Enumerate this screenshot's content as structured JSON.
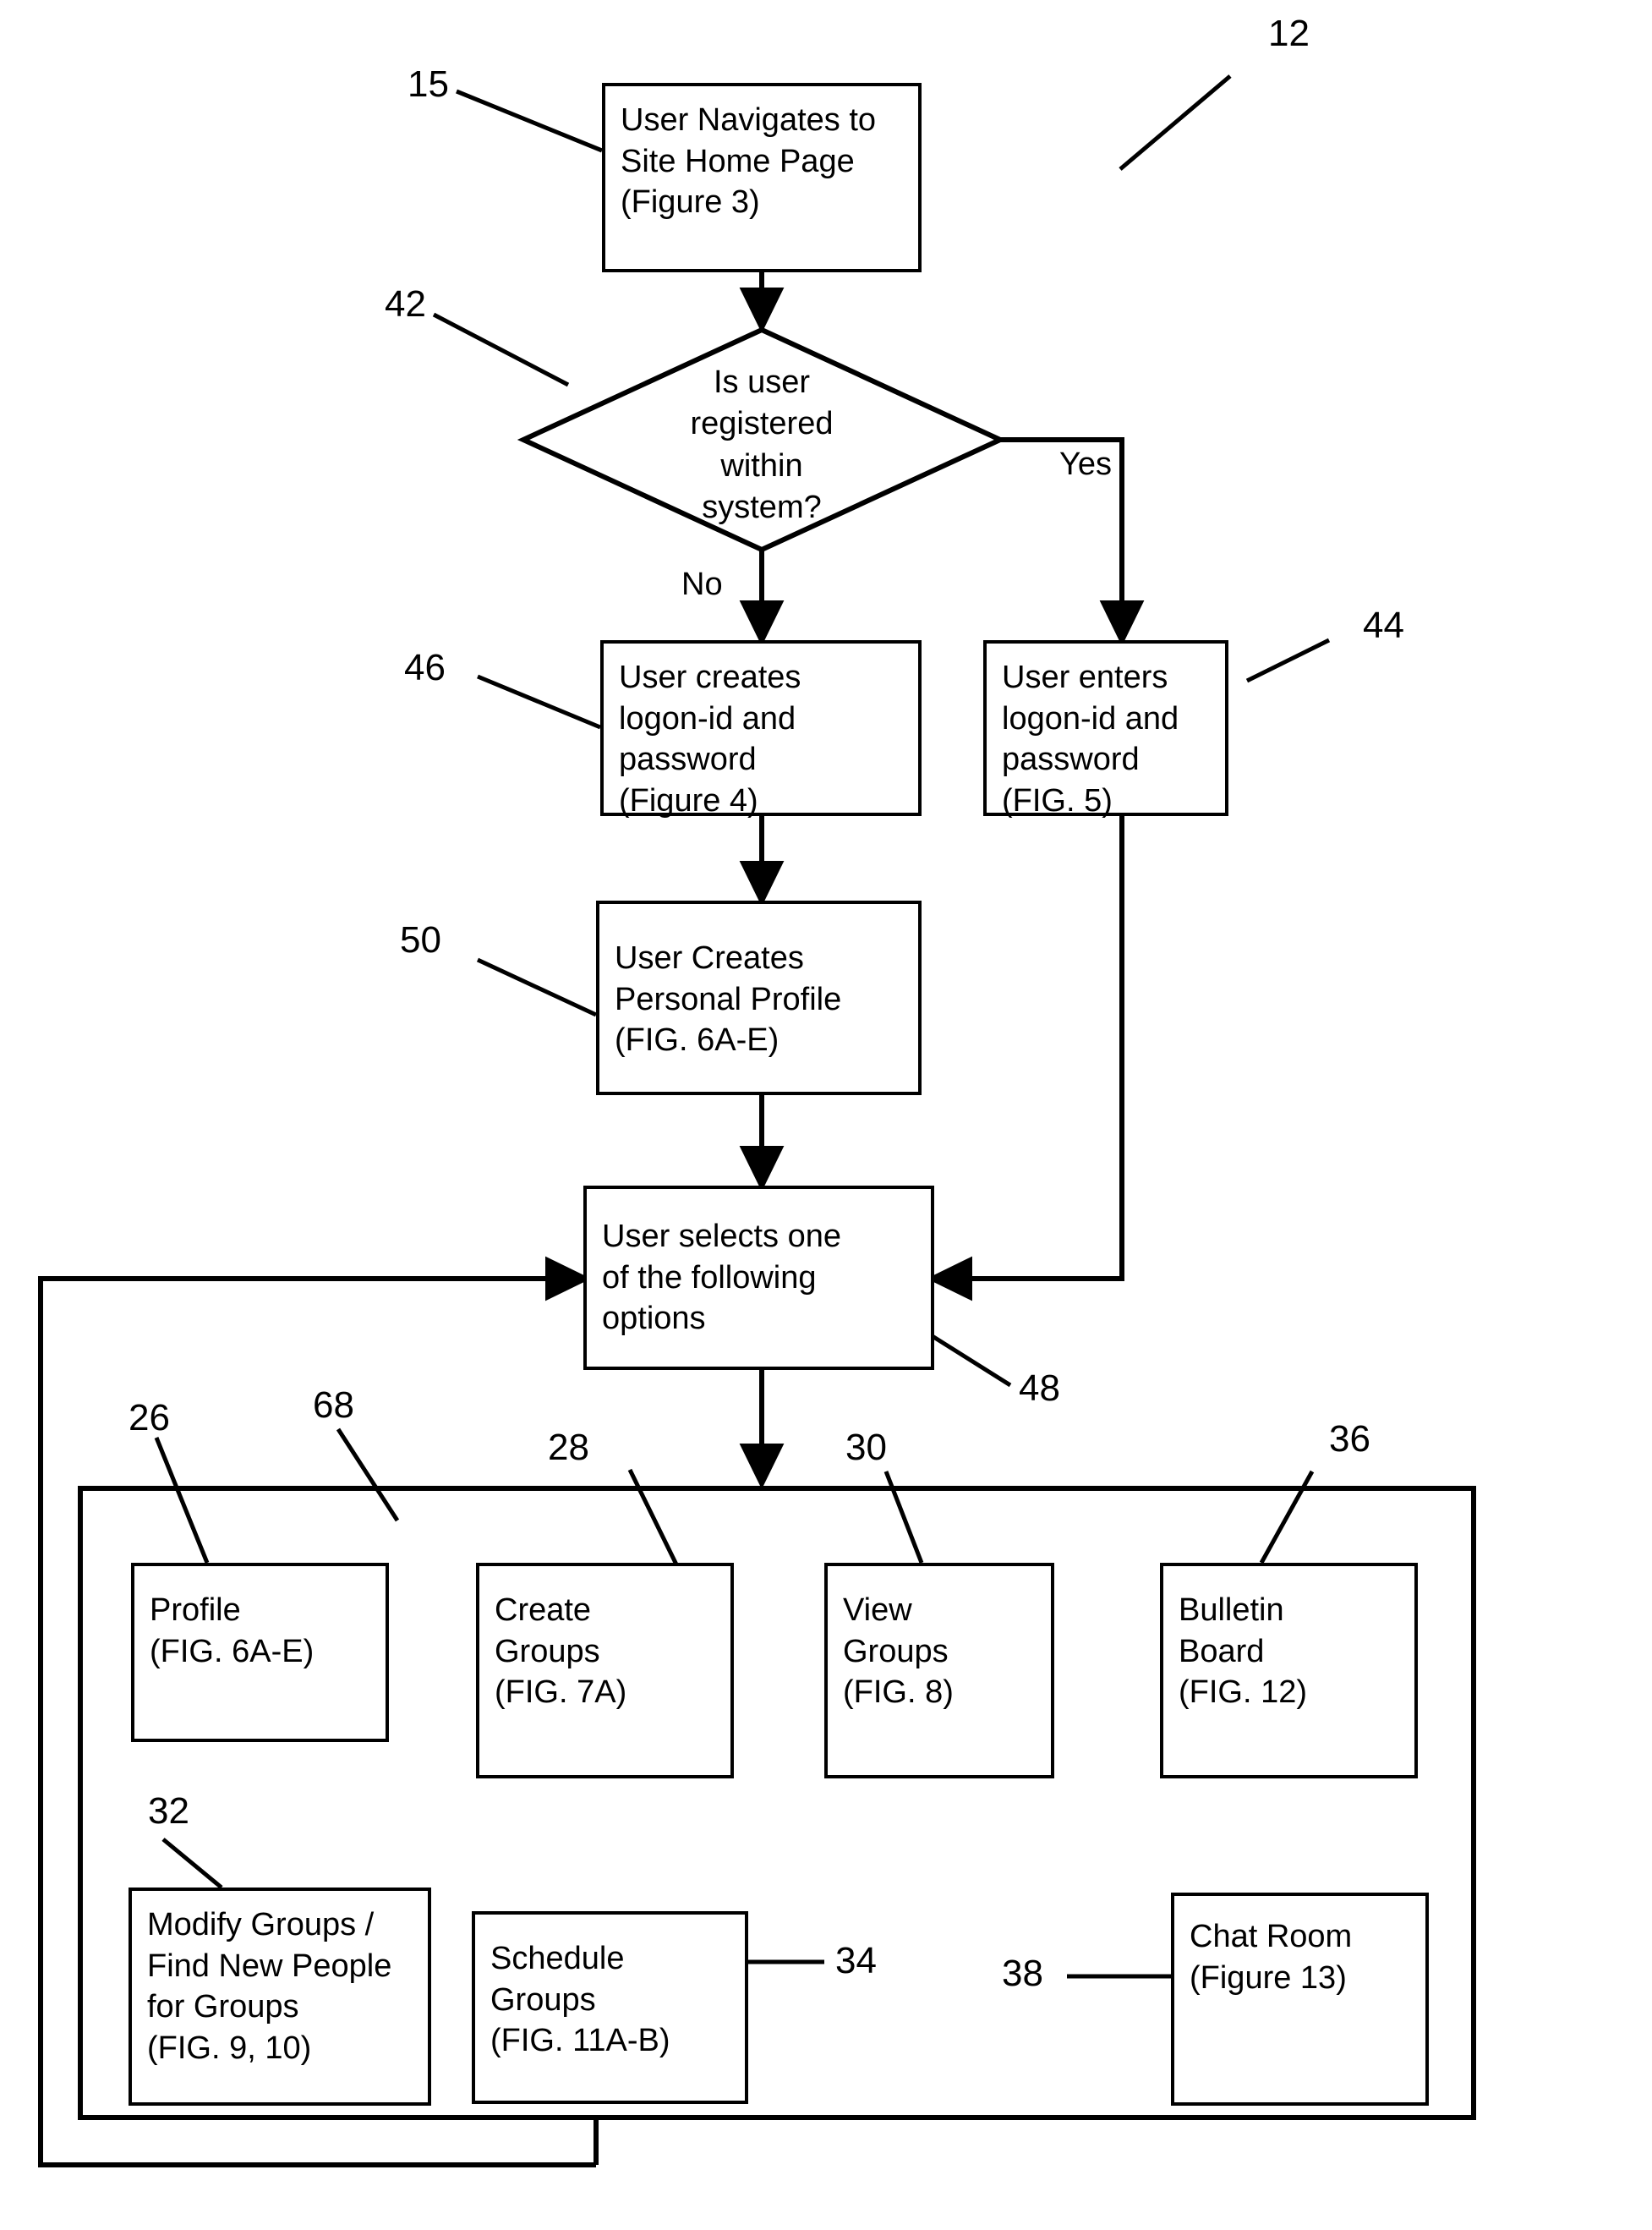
{
  "figure": {
    "title_numeral": "12"
  },
  "nodes": {
    "home_page": {
      "ref": "15",
      "lines": [
        "User Navigates to",
        "Site Home Page",
        "(Figure 3)"
      ]
    },
    "decision": {
      "ref": "42",
      "lines": [
        "Is user",
        "registered",
        "within",
        "system?"
      ],
      "branch_no": "No",
      "branch_yes": "Yes"
    },
    "creates_logon": {
      "ref": "46",
      "lines": [
        "User creates",
        "logon-id and",
        "password",
        "(Figure 4)"
      ]
    },
    "enters_logon": {
      "ref": "44",
      "lines": [
        "User enters",
        "logon-id and",
        "password",
        "(FIG. 5)"
      ]
    },
    "personal_profile": {
      "ref": "50",
      "lines": [
        "User Creates",
        "Personal Profile",
        "(FIG. 6A-E)"
      ]
    },
    "select_options": {
      "ref": "48",
      "lines": [
        "User selects one",
        "of the following",
        "options"
      ]
    }
  },
  "options_container": {
    "ref": "68"
  },
  "options": [
    {
      "ref": "26",
      "name": "profile",
      "lines": [
        "Profile",
        "(FIG. 6A-E)"
      ]
    },
    {
      "ref": "28",
      "name": "create-groups",
      "lines": [
        "Create",
        "Groups",
        "(FIG. 7A)"
      ]
    },
    {
      "ref": "30",
      "name": "view-groups",
      "lines": [
        "View",
        "Groups",
        "(FIG. 8)"
      ]
    },
    {
      "ref": "36",
      "name": "bulletin-board",
      "lines": [
        "Bulletin",
        "Board",
        "(FIG. 12)"
      ]
    },
    {
      "ref": "32",
      "name": "modify-groups",
      "lines": [
        "Modify Groups /",
        "Find New People",
        "for Groups",
        "(FIG. 9, 10)"
      ]
    },
    {
      "ref": "34",
      "name": "schedule-groups",
      "lines": [
        "Schedule",
        "Groups",
        "(FIG. 11A-B)"
      ]
    },
    {
      "ref": "38",
      "name": "chat-room",
      "lines": [
        "Chat Room",
        "(Figure 13)"
      ]
    }
  ],
  "colors": {
    "ink": "#000000",
    "paper": "#ffffff"
  }
}
